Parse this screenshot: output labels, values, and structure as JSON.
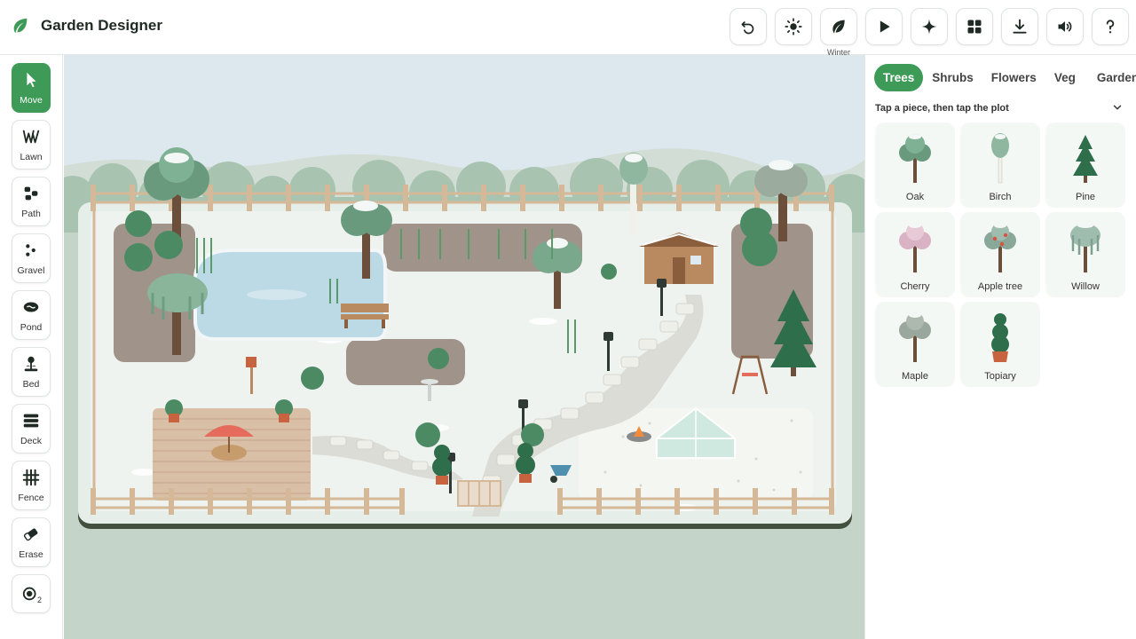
{
  "app": {
    "title": "Garden Designer",
    "logo_icon": "leaf-icon"
  },
  "toolbar": {
    "undo": {
      "icon": "undo-icon"
    },
    "daylight": {
      "icon": "sun-icon"
    },
    "season": {
      "icon": "leaf-icon",
      "label": "Winter"
    },
    "play": {
      "icon": "play-icon"
    },
    "sparkle": {
      "icon": "sparkle-icon"
    },
    "layout": {
      "icon": "grid-icon"
    },
    "download": {
      "icon": "download-icon"
    },
    "sound": {
      "icon": "speaker-icon"
    },
    "help": {
      "icon": "question-icon"
    }
  },
  "tools": [
    {
      "label": "Move",
      "icon": "pointer-icon",
      "active": true
    },
    {
      "label": "Lawn",
      "icon": "grass-icon"
    },
    {
      "label": "Path",
      "icon": "stones-icon"
    },
    {
      "label": "Gravel",
      "icon": "gravel-icon"
    },
    {
      "label": "Pond",
      "icon": "pond-icon"
    },
    {
      "label": "Bed",
      "icon": "plant-icon"
    },
    {
      "label": "Deck",
      "icon": "deck-icon"
    },
    {
      "label": "Fence",
      "icon": "fence-icon"
    },
    {
      "label": "Erase",
      "icon": "eraser-icon"
    }
  ],
  "brush": {
    "icon": "brush-size-icon",
    "size": "2"
  },
  "palette": {
    "tabs": [
      "Trees",
      "Shrubs",
      "Flowers",
      "Veg",
      "Garden"
    ],
    "active_tab": "Trees",
    "hint": "Tap a piece, then tap the plot",
    "items": [
      {
        "label": "Oak",
        "icon": "oak-tree-icon"
      },
      {
        "label": "Birch",
        "icon": "birch-tree-icon"
      },
      {
        "label": "Pine",
        "icon": "pine-tree-icon"
      },
      {
        "label": "Cherry",
        "icon": "cherry-tree-icon"
      },
      {
        "label": "Apple tree",
        "icon": "apple-tree-icon"
      },
      {
        "label": "Willow",
        "icon": "willow-tree-icon"
      },
      {
        "label": "Maple",
        "icon": "maple-tree-icon"
      },
      {
        "label": "Topiary",
        "icon": "topiary-icon"
      }
    ]
  },
  "colors": {
    "accent": "#3e9a57",
    "sky": "#dde8ee",
    "snow": "#eef3f0",
    "soil": "#a0938a",
    "water": "#bcd9e6",
    "deck": "#d8bfa6",
    "fence": "#d4b898"
  }
}
